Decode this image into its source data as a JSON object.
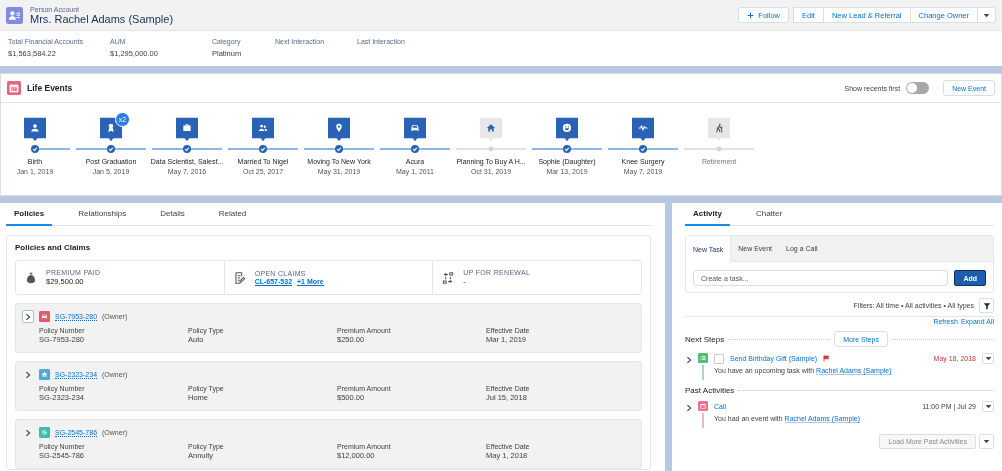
{
  "header": {
    "object_type": "Person Account",
    "title": "Mrs. Rachel Adams (Sample)",
    "actions": [
      {
        "kind": "follow",
        "label": "Follow"
      },
      {
        "kind": "plain",
        "label": "Edit"
      },
      {
        "kind": "plain",
        "label": "New Lead & Referral"
      },
      {
        "kind": "plain",
        "label": "Change Owner"
      },
      {
        "kind": "menu"
      }
    ],
    "fields": [
      {
        "label": "Total Financial Accounts",
        "value": "$1,563,584.22"
      },
      {
        "label": "AUM",
        "value": "$1,295,000.00"
      },
      {
        "label": "Category",
        "value": "Platinum"
      },
      {
        "label": "Next Interaction"
      },
      {
        "label": "Last Interaction"
      }
    ]
  },
  "life_events": {
    "title": "Life Events",
    "toggle_label": "Show recents first",
    "toggle_on": false,
    "new_button": "New Event",
    "events": [
      {
        "kind": "person",
        "label": "Birth",
        "date": "Jan 1, 2019",
        "completed": true
      },
      {
        "kind": "award",
        "label": "Post Graduation",
        "date": "Jan 5, 2019",
        "completed": true,
        "badge": "x2"
      },
      {
        "kind": "briefcase",
        "label": "Data Scientist, Salesf...",
        "date": "May 7, 2016",
        "completed": true
      },
      {
        "kind": "people",
        "label": "Married To Nigel",
        "date": "Oct 25, 2017",
        "completed": true
      },
      {
        "kind": "pin",
        "label": "Moving To New York",
        "date": "May 31, 2019",
        "completed": true
      },
      {
        "kind": "car",
        "label": "Acura",
        "date": "May 1, 2011",
        "completed": true
      },
      {
        "kind": "home",
        "label": "Planning To Buy A H...",
        "date": "Oct 31, 2019",
        "completed": false
      },
      {
        "kind": "smile",
        "label": "Sophie (Daughter)",
        "date": "Mar 13, 2019",
        "completed": true
      },
      {
        "kind": "pulse",
        "label": "Knee Surgery",
        "date": "May 7, 2019",
        "completed": true
      },
      {
        "kind": "hiker",
        "label": "Retirement",
        "completed": false
      }
    ]
  },
  "left_tabs": [
    {
      "label": "Policies",
      "selected": true
    },
    {
      "label": "Relationships",
      "selected": false
    },
    {
      "label": "Details",
      "selected": false
    },
    {
      "label": "Related",
      "selected": false
    }
  ],
  "policies": {
    "title": "Policies and Claims",
    "summary": [
      {
        "kind": "money",
        "label": "PREMIUM PAID",
        "value": "$29,500.00"
      },
      {
        "kind": "claims",
        "label": "OPEN CLAIMS",
        "links": [
          "CL-657-532",
          "+1 More"
        ]
      },
      {
        "kind": "renewal",
        "label": "UP FOR RENEWAL",
        "value": "-"
      }
    ],
    "rows": [
      {
        "kind": "car",
        "color": "#e2596e",
        "number": "SG-7953-280",
        "role": "(Owner)",
        "focused": true,
        "fields": [
          {
            "label": "Policy Number",
            "value": "SG-7953-280"
          },
          {
            "label": "Policy Type",
            "value": "Auto"
          },
          {
            "label": "Premium Amount",
            "value": "$250.00"
          },
          {
            "label": "Effective Date",
            "value": "Mar 1, 2019"
          }
        ]
      },
      {
        "kind": "home",
        "color": "#4fa9d4",
        "number": "SG-2323-234",
        "role": "(Owner)",
        "focused": false,
        "fields": [
          {
            "label": "Policy Number",
            "value": "SG-2323-234"
          },
          {
            "label": "Policy Type",
            "value": "Home"
          },
          {
            "label": "Premium Amount",
            "value": "$500.00"
          },
          {
            "label": "Effective Date",
            "value": "Jul 15, 2018"
          }
        ]
      },
      {
        "kind": "annuity",
        "color": "#3fbea6",
        "number": "SG-2545-786",
        "role": "(Owner)",
        "focused": false,
        "fields": [
          {
            "label": "Policy Number",
            "value": "SG-2545-786"
          },
          {
            "label": "Policy Type",
            "value": "Annuity"
          },
          {
            "label": "Premium Amount",
            "value": "$12,000.00"
          },
          {
            "label": "Effective Date",
            "value": "May 1, 2018"
          }
        ]
      }
    ]
  },
  "right_tabs": [
    {
      "label": "Activity",
      "selected": true
    },
    {
      "label": "Chatter",
      "selected": false
    }
  ],
  "composer": {
    "tabs": [
      {
        "label": "New Task",
        "selected": true
      },
      {
        "label": "New Event",
        "selected": false
      },
      {
        "label": "Log a Call",
        "selected": false
      }
    ],
    "placeholder": "Create a task...",
    "button": "Add"
  },
  "filters": "Filters: All time • All activities • All types",
  "links": [
    "Refresh",
    "Expand All"
  ],
  "next_steps": {
    "title": "Next Steps",
    "button": "More Steps",
    "items": [
      {
        "kind": "task",
        "title": "Send Birthday Gift (Sample)",
        "checked": false,
        "flagged": true,
        "date": "May 18, 2018",
        "overdue": true,
        "text": "You have an upcoming task with",
        "link": "Rachel Adams (Sample)"
      }
    ]
  },
  "past": {
    "title": "Past Activities",
    "items": [
      {
        "kind": "event",
        "title": "Call",
        "date": "11:00 PM | Jul 29",
        "overdue": false,
        "text": "You had an event with",
        "link": "Rachel Adams (Sample)"
      }
    ],
    "load_button": "Load More Past Activities",
    "load_disabled": true
  }
}
